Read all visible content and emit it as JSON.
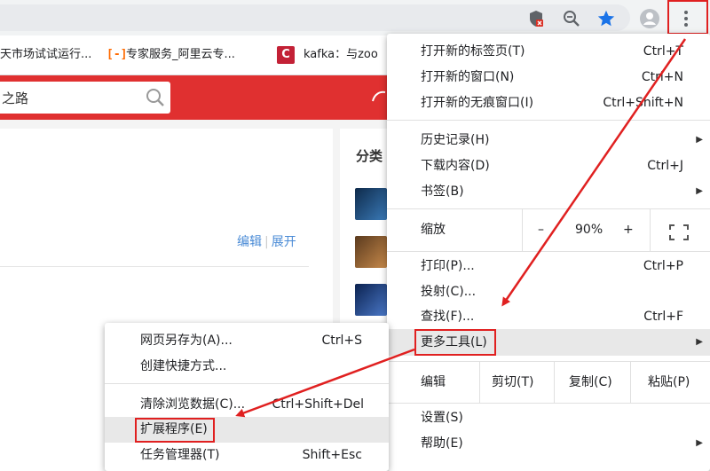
{
  "toolbar": {
    "icons": [
      "shield-blocked-icon",
      "zoom-icon",
      "star-icon",
      "profile-icon",
      "more-vert-icon"
    ]
  },
  "bookmarks": [
    {
      "label": "天市场试试运行..."
    },
    {
      "label": "专家服务_阿里云专..."
    },
    {
      "label": "kafka：与zoo"
    }
  ],
  "page": {
    "search_text": "之路",
    "sidebar_title": "分类",
    "edit_link": "编辑",
    "expand_link": "展开"
  },
  "menu": {
    "new_tab": {
      "label": "打开新的标签页(T)",
      "shortcut": "Ctrl+T"
    },
    "new_window": {
      "label": "打开新的窗口(N)",
      "shortcut": "Ctrl+N"
    },
    "incognito": {
      "label": "打开新的无痕窗口(I)",
      "shortcut": "Ctrl+Shift+N"
    },
    "history": {
      "label": "历史记录(H)"
    },
    "downloads": {
      "label": "下载内容(D)",
      "shortcut": "Ctrl+J"
    },
    "bookmarks": {
      "label": "书签(B)"
    },
    "zoom": {
      "label": "缩放",
      "minus": "–",
      "value": "90%",
      "plus": "+"
    },
    "print": {
      "label": "打印(P)...",
      "shortcut": "Ctrl+P"
    },
    "cast": {
      "label": "投射(C)..."
    },
    "find": {
      "label": "查找(F)...",
      "shortcut": "Ctrl+F"
    },
    "more_tools": {
      "label": "更多工具(L)"
    },
    "edit": {
      "label": "编辑",
      "cut": "剪切(T)",
      "copy": "复制(C)",
      "paste": "粘贴(P)"
    },
    "settings": {
      "label": "设置(S)"
    },
    "help": {
      "label": "帮助(E)"
    }
  },
  "submenu": {
    "save_as": {
      "label": "网页另存为(A)...",
      "shortcut": "Ctrl+S"
    },
    "shortcut": {
      "label": "创建快捷方式..."
    },
    "clear_data": {
      "label": "清除浏览数据(C)...",
      "shortcut": "Ctrl+Shift+Del"
    },
    "extensions": {
      "label": "扩展程序(E)"
    },
    "task_manager": {
      "label": "任务管理器(T)",
      "shortcut": "Shift+Esc"
    }
  },
  "colors": {
    "annotation": "#e02020",
    "brand_red": "#e03030",
    "star": "#1a73e8"
  }
}
